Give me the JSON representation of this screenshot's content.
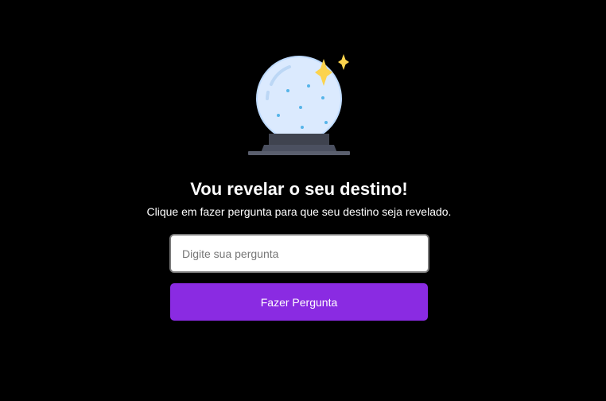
{
  "hero": {
    "icon": "crystal-ball-icon",
    "sparkle_color": "#fcd34d",
    "globe_color": "#dbeafe",
    "base_color": "#3f434f"
  },
  "title": "Vou revelar o seu destino!",
  "subtitle": "Clique em fazer pergunta para que seu destino seja revelado.",
  "question": {
    "value": "",
    "placeholder": "Digite sua pergunta"
  },
  "ask_button": {
    "label": "Fazer Pergunta",
    "color": "#8a2be2"
  }
}
